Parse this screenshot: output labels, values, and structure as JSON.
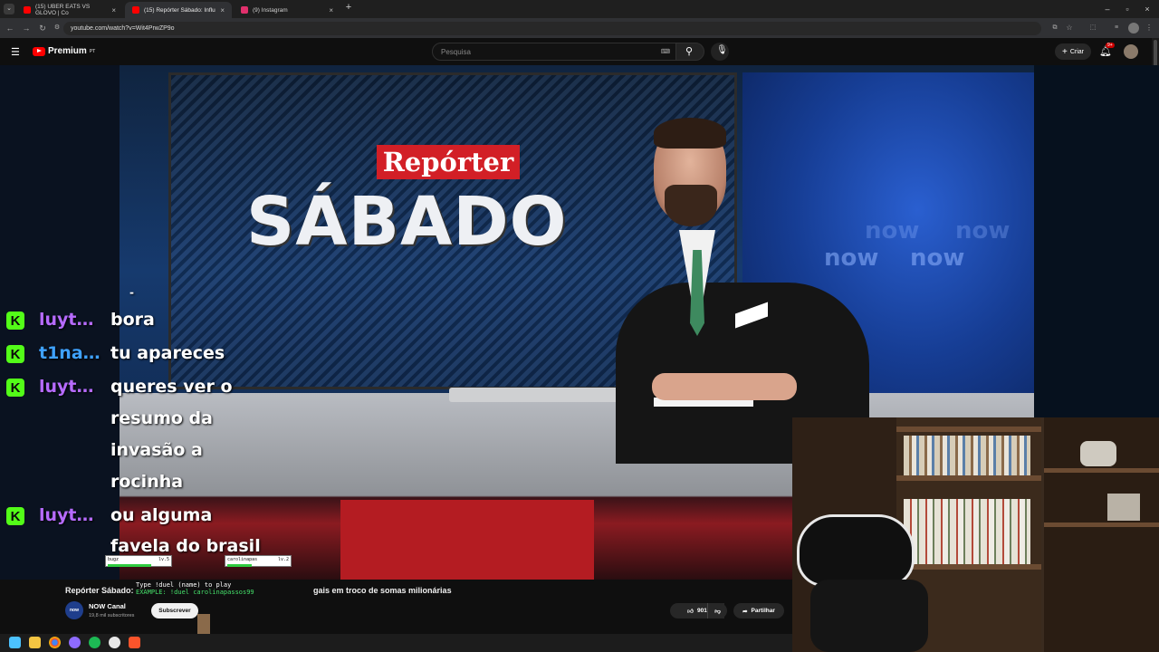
{
  "browser": {
    "tabs": [
      {
        "label": "(15) UBER EATS VS GLOVO | Co",
        "favicon_color": "#ff0000",
        "active": false
      },
      {
        "label": "(15) Repórter Sábado: Influenci",
        "favicon_color": "#ff0000",
        "active": true
      },
      {
        "label": "(9) Instagram",
        "favicon_color": "#e1306c",
        "active": false
      }
    ],
    "new_tab": "+",
    "url": "youtube.com/watch?v=Wit4PrwZP9o"
  },
  "youtube": {
    "logo_text": "Premium",
    "logo_suffix": "PT",
    "search_placeholder": "Pesquisa",
    "create_label": "Criar",
    "notif_count": "9+"
  },
  "video": {
    "banner_top": "Repórter",
    "banner_main": "SÁBADO",
    "bg_brand": "now",
    "dash": "-"
  },
  "chat": [
    {
      "user": "luyt…",
      "color": "#b66bff",
      "lines": [
        "bora"
      ]
    },
    {
      "user": "t1na…",
      "color": "#3fa2ff",
      "lines": [
        "tu apareces"
      ]
    },
    {
      "user": "luyt…",
      "color": "#b66bff",
      "lines": [
        "queres ver o",
        "resumo da",
        "invasão a",
        "rocinha"
      ]
    },
    {
      "user": "luyt…",
      "color": "#b66bff",
      "lines": [
        "ou alguma",
        "favela do brasil"
      ]
    }
  ],
  "duel": {
    "left_name": "bugz",
    "left_lvl": "lv.5",
    "right_name": "carolinapas",
    "right_lvl": "lv.2",
    "cmd": "Type !duel (name) to play",
    "result": "EXAMPLE: !duel carolinapassos99"
  },
  "below": {
    "title": "Repórter Sábado: ",
    "title_tail": "gais em troco de somas milionárias",
    "channel": "NOW Canal",
    "channel_badge": "now",
    "subscribers": "19,8 mil subscritores",
    "subscribe": "Subscrever",
    "likes": "901",
    "share": "Partilhar"
  },
  "taskbar": {
    "icons": [
      "windows-start",
      "file-explorer",
      "chrome",
      "messenger",
      "spotify",
      "github",
      "brave"
    ],
    "colors": [
      "#4cc2ff",
      "#f5c542",
      "#4285f4",
      "#8e6bff",
      "#1db954",
      "#e8e8e8",
      "#fb542b"
    ]
  }
}
